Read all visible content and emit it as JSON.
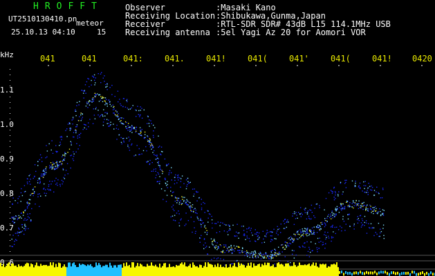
{
  "header": {
    "logo": "HROFFT",
    "filename": "UT2510130410.pn",
    "meteor_label": "meteor",
    "datetime": "25.10.13 04:10",
    "count": "15",
    "fields": [
      {
        "label": "Observer",
        "value": ":Masaki Kano"
      },
      {
        "label": "Receiving Location",
        "value": ":Shibukawa,Gunma,Japan"
      },
      {
        "label": "Receiver",
        "value": ":RTL-SDR SDR# 43dB L15 114.1MHz USB"
      },
      {
        "label": "Receiving antenna",
        "value": ":5el Yagi Az 20 for Aomori VOR"
      }
    ]
  },
  "colors": {
    "background": "#000000",
    "logo": "#22ee22",
    "time_labels": "#e8e800",
    "signal_low": "#1a2aff",
    "signal_high": "#7fe0ff",
    "signal_peak": "#f0f020",
    "baseline": "#f7f700",
    "baseline_low": "#20c0ff"
  },
  "time_axis": {
    "labels": [
      "041",
      "041",
      "041:",
      "041.",
      "041!",
      "041(",
      "041'",
      "041(",
      "041!",
      "0420"
    ]
  },
  "freq_axis": {
    "unit": "kHz",
    "labels": [
      "1.1",
      "1.0",
      "0.9",
      "0.8",
      "0.7",
      "0.6"
    ]
  },
  "chart_data": {
    "type": "scatter",
    "xlabel": "",
    "ylabel": "kHz",
    "ylim": [
      0.58,
      1.18
    ],
    "series": [
      {
        "x": [
          0,
          10,
          20,
          30,
          40,
          50,
          60,
          70,
          80,
          90,
          100
        ],
        "y": [
          0.72,
          0.88,
          1.08,
          0.98,
          0.78,
          0.64,
          0.62,
          0.69,
          0.77,
          0.74,
          0.6
        ]
      }
    ]
  }
}
